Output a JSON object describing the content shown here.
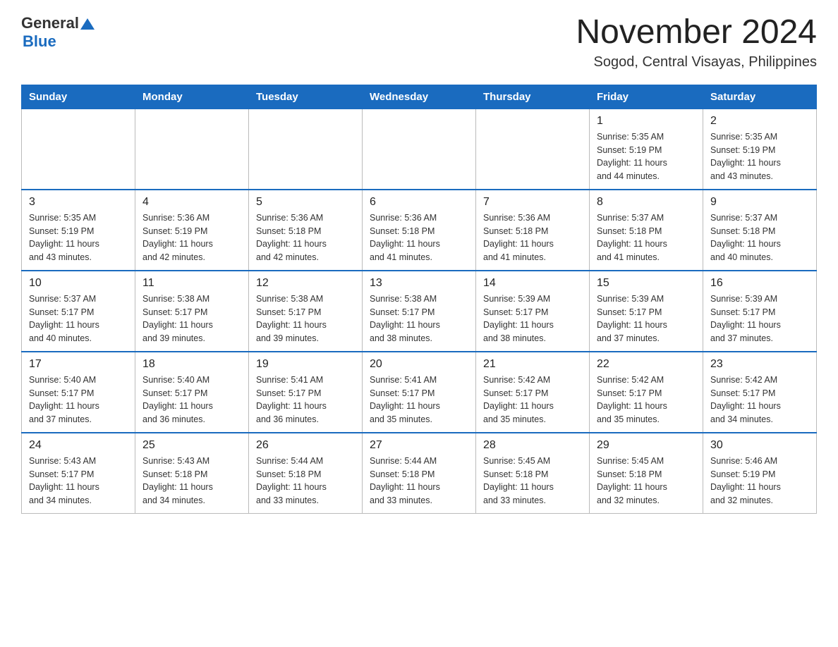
{
  "header": {
    "logo_general": "General",
    "logo_blue": "Blue",
    "title": "November 2024",
    "subtitle": "Sogod, Central Visayas, Philippines"
  },
  "calendar": {
    "days_of_week": [
      "Sunday",
      "Monday",
      "Tuesday",
      "Wednesday",
      "Thursday",
      "Friday",
      "Saturday"
    ],
    "weeks": [
      [
        {
          "day": "",
          "info": ""
        },
        {
          "day": "",
          "info": ""
        },
        {
          "day": "",
          "info": ""
        },
        {
          "day": "",
          "info": ""
        },
        {
          "day": "",
          "info": ""
        },
        {
          "day": "1",
          "info": "Sunrise: 5:35 AM\nSunset: 5:19 PM\nDaylight: 11 hours\nand 44 minutes."
        },
        {
          "day": "2",
          "info": "Sunrise: 5:35 AM\nSunset: 5:19 PM\nDaylight: 11 hours\nand 43 minutes."
        }
      ],
      [
        {
          "day": "3",
          "info": "Sunrise: 5:35 AM\nSunset: 5:19 PM\nDaylight: 11 hours\nand 43 minutes."
        },
        {
          "day": "4",
          "info": "Sunrise: 5:36 AM\nSunset: 5:19 PM\nDaylight: 11 hours\nand 42 minutes."
        },
        {
          "day": "5",
          "info": "Sunrise: 5:36 AM\nSunset: 5:18 PM\nDaylight: 11 hours\nand 42 minutes."
        },
        {
          "day": "6",
          "info": "Sunrise: 5:36 AM\nSunset: 5:18 PM\nDaylight: 11 hours\nand 41 minutes."
        },
        {
          "day": "7",
          "info": "Sunrise: 5:36 AM\nSunset: 5:18 PM\nDaylight: 11 hours\nand 41 minutes."
        },
        {
          "day": "8",
          "info": "Sunrise: 5:37 AM\nSunset: 5:18 PM\nDaylight: 11 hours\nand 41 minutes."
        },
        {
          "day": "9",
          "info": "Sunrise: 5:37 AM\nSunset: 5:18 PM\nDaylight: 11 hours\nand 40 minutes."
        }
      ],
      [
        {
          "day": "10",
          "info": "Sunrise: 5:37 AM\nSunset: 5:17 PM\nDaylight: 11 hours\nand 40 minutes."
        },
        {
          "day": "11",
          "info": "Sunrise: 5:38 AM\nSunset: 5:17 PM\nDaylight: 11 hours\nand 39 minutes."
        },
        {
          "day": "12",
          "info": "Sunrise: 5:38 AM\nSunset: 5:17 PM\nDaylight: 11 hours\nand 39 minutes."
        },
        {
          "day": "13",
          "info": "Sunrise: 5:38 AM\nSunset: 5:17 PM\nDaylight: 11 hours\nand 38 minutes."
        },
        {
          "day": "14",
          "info": "Sunrise: 5:39 AM\nSunset: 5:17 PM\nDaylight: 11 hours\nand 38 minutes."
        },
        {
          "day": "15",
          "info": "Sunrise: 5:39 AM\nSunset: 5:17 PM\nDaylight: 11 hours\nand 37 minutes."
        },
        {
          "day": "16",
          "info": "Sunrise: 5:39 AM\nSunset: 5:17 PM\nDaylight: 11 hours\nand 37 minutes."
        }
      ],
      [
        {
          "day": "17",
          "info": "Sunrise: 5:40 AM\nSunset: 5:17 PM\nDaylight: 11 hours\nand 37 minutes."
        },
        {
          "day": "18",
          "info": "Sunrise: 5:40 AM\nSunset: 5:17 PM\nDaylight: 11 hours\nand 36 minutes."
        },
        {
          "day": "19",
          "info": "Sunrise: 5:41 AM\nSunset: 5:17 PM\nDaylight: 11 hours\nand 36 minutes."
        },
        {
          "day": "20",
          "info": "Sunrise: 5:41 AM\nSunset: 5:17 PM\nDaylight: 11 hours\nand 35 minutes."
        },
        {
          "day": "21",
          "info": "Sunrise: 5:42 AM\nSunset: 5:17 PM\nDaylight: 11 hours\nand 35 minutes."
        },
        {
          "day": "22",
          "info": "Sunrise: 5:42 AM\nSunset: 5:17 PM\nDaylight: 11 hours\nand 35 minutes."
        },
        {
          "day": "23",
          "info": "Sunrise: 5:42 AM\nSunset: 5:17 PM\nDaylight: 11 hours\nand 34 minutes."
        }
      ],
      [
        {
          "day": "24",
          "info": "Sunrise: 5:43 AM\nSunset: 5:17 PM\nDaylight: 11 hours\nand 34 minutes."
        },
        {
          "day": "25",
          "info": "Sunrise: 5:43 AM\nSunset: 5:18 PM\nDaylight: 11 hours\nand 34 minutes."
        },
        {
          "day": "26",
          "info": "Sunrise: 5:44 AM\nSunset: 5:18 PM\nDaylight: 11 hours\nand 33 minutes."
        },
        {
          "day": "27",
          "info": "Sunrise: 5:44 AM\nSunset: 5:18 PM\nDaylight: 11 hours\nand 33 minutes."
        },
        {
          "day": "28",
          "info": "Sunrise: 5:45 AM\nSunset: 5:18 PM\nDaylight: 11 hours\nand 33 minutes."
        },
        {
          "day": "29",
          "info": "Sunrise: 5:45 AM\nSunset: 5:18 PM\nDaylight: 11 hours\nand 32 minutes."
        },
        {
          "day": "30",
          "info": "Sunrise: 5:46 AM\nSunset: 5:19 PM\nDaylight: 11 hours\nand 32 minutes."
        }
      ]
    ]
  }
}
